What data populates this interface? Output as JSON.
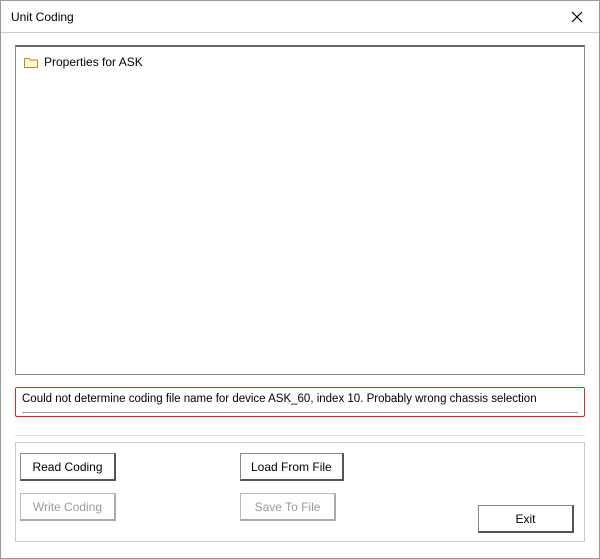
{
  "window": {
    "title": "Unit Coding"
  },
  "tree": {
    "root_label": "Properties for ASK"
  },
  "status": {
    "message": "Could not determine coding file name for device ASK_60, index 10. Probably wrong chassis selection"
  },
  "buttons": {
    "read_coding": "Read Coding",
    "write_coding": "Write Coding",
    "load_from_file": "Load From File",
    "save_to_file": "Save To File",
    "exit": "Exit"
  }
}
